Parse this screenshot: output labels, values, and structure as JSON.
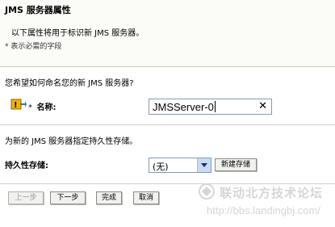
{
  "header": {
    "title": "JMS 服务器属性",
    "intro": "以下属性将用于标识新 JMS 服务器。",
    "required_note": "* 表示必需的字段"
  },
  "name_section": {
    "question": "您希望如何命名您的新 JMS 服务器?",
    "required_star": "*",
    "label": "名称:",
    "value": "JMSServer-0",
    "clear_symbol": "✕"
  },
  "store_section": {
    "question": "为新的 JMS 服务器指定持久性存储。",
    "label": "持久性存储:",
    "selected": "(无)",
    "new_button": "新建存储"
  },
  "wizard_buttons": {
    "back": "上一步",
    "next": "下一步",
    "finish": "完成",
    "cancel": "取消"
  },
  "watermark": {
    "text": "联动北方技术论坛",
    "url": "http://bbs.landingbj.com/"
  },
  "colors": {
    "warning": "#f0b400",
    "input_border": "#7f9db9",
    "watermark": "#d6d6d6"
  },
  "icons": [
    "warning-icon",
    "clear-icon",
    "dropdown-arrow-icon",
    "forum-logo-icon"
  ]
}
